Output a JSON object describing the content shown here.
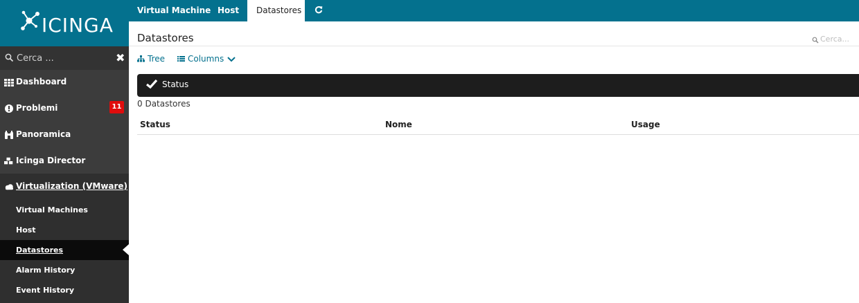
{
  "brand": {
    "name": "ICINGA",
    "color": "#04718e"
  },
  "sidebar": {
    "search_placeholder": "Cerca ...",
    "clear_icon": "close-icon",
    "items": [
      {
        "label": "Dashboard",
        "icon": "grid-icon"
      },
      {
        "label": "Problemi",
        "icon": "alert-circle-icon",
        "badge": "11"
      },
      {
        "label": "Panoramica",
        "icon": "binoculars-icon"
      },
      {
        "label": "Icinga Director",
        "icon": "cubes-icon"
      },
      {
        "label": "Virtualization (VMware)",
        "icon": "cloud-icon",
        "expanded": true
      }
    ],
    "subitems": [
      {
        "label": "Virtual Machines"
      },
      {
        "label": "Host"
      },
      {
        "label": "Datastores",
        "active": true
      },
      {
        "label": "Alarm History"
      },
      {
        "label": "Event History"
      }
    ]
  },
  "tabs": [
    {
      "label": "Virtual Machine"
    },
    {
      "label": "Host"
    },
    {
      "label": "Datastores",
      "active": true
    },
    {
      "icon": "refresh-icon"
    }
  ],
  "main": {
    "title": "Datastores",
    "search_placeholder": "Cerca...",
    "controls": {
      "tree": "Tree",
      "columns": "Columns"
    },
    "status_label": "Status",
    "count_text": "0 Datastores",
    "columns": [
      "Status",
      "Nome",
      "Usage"
    ]
  }
}
